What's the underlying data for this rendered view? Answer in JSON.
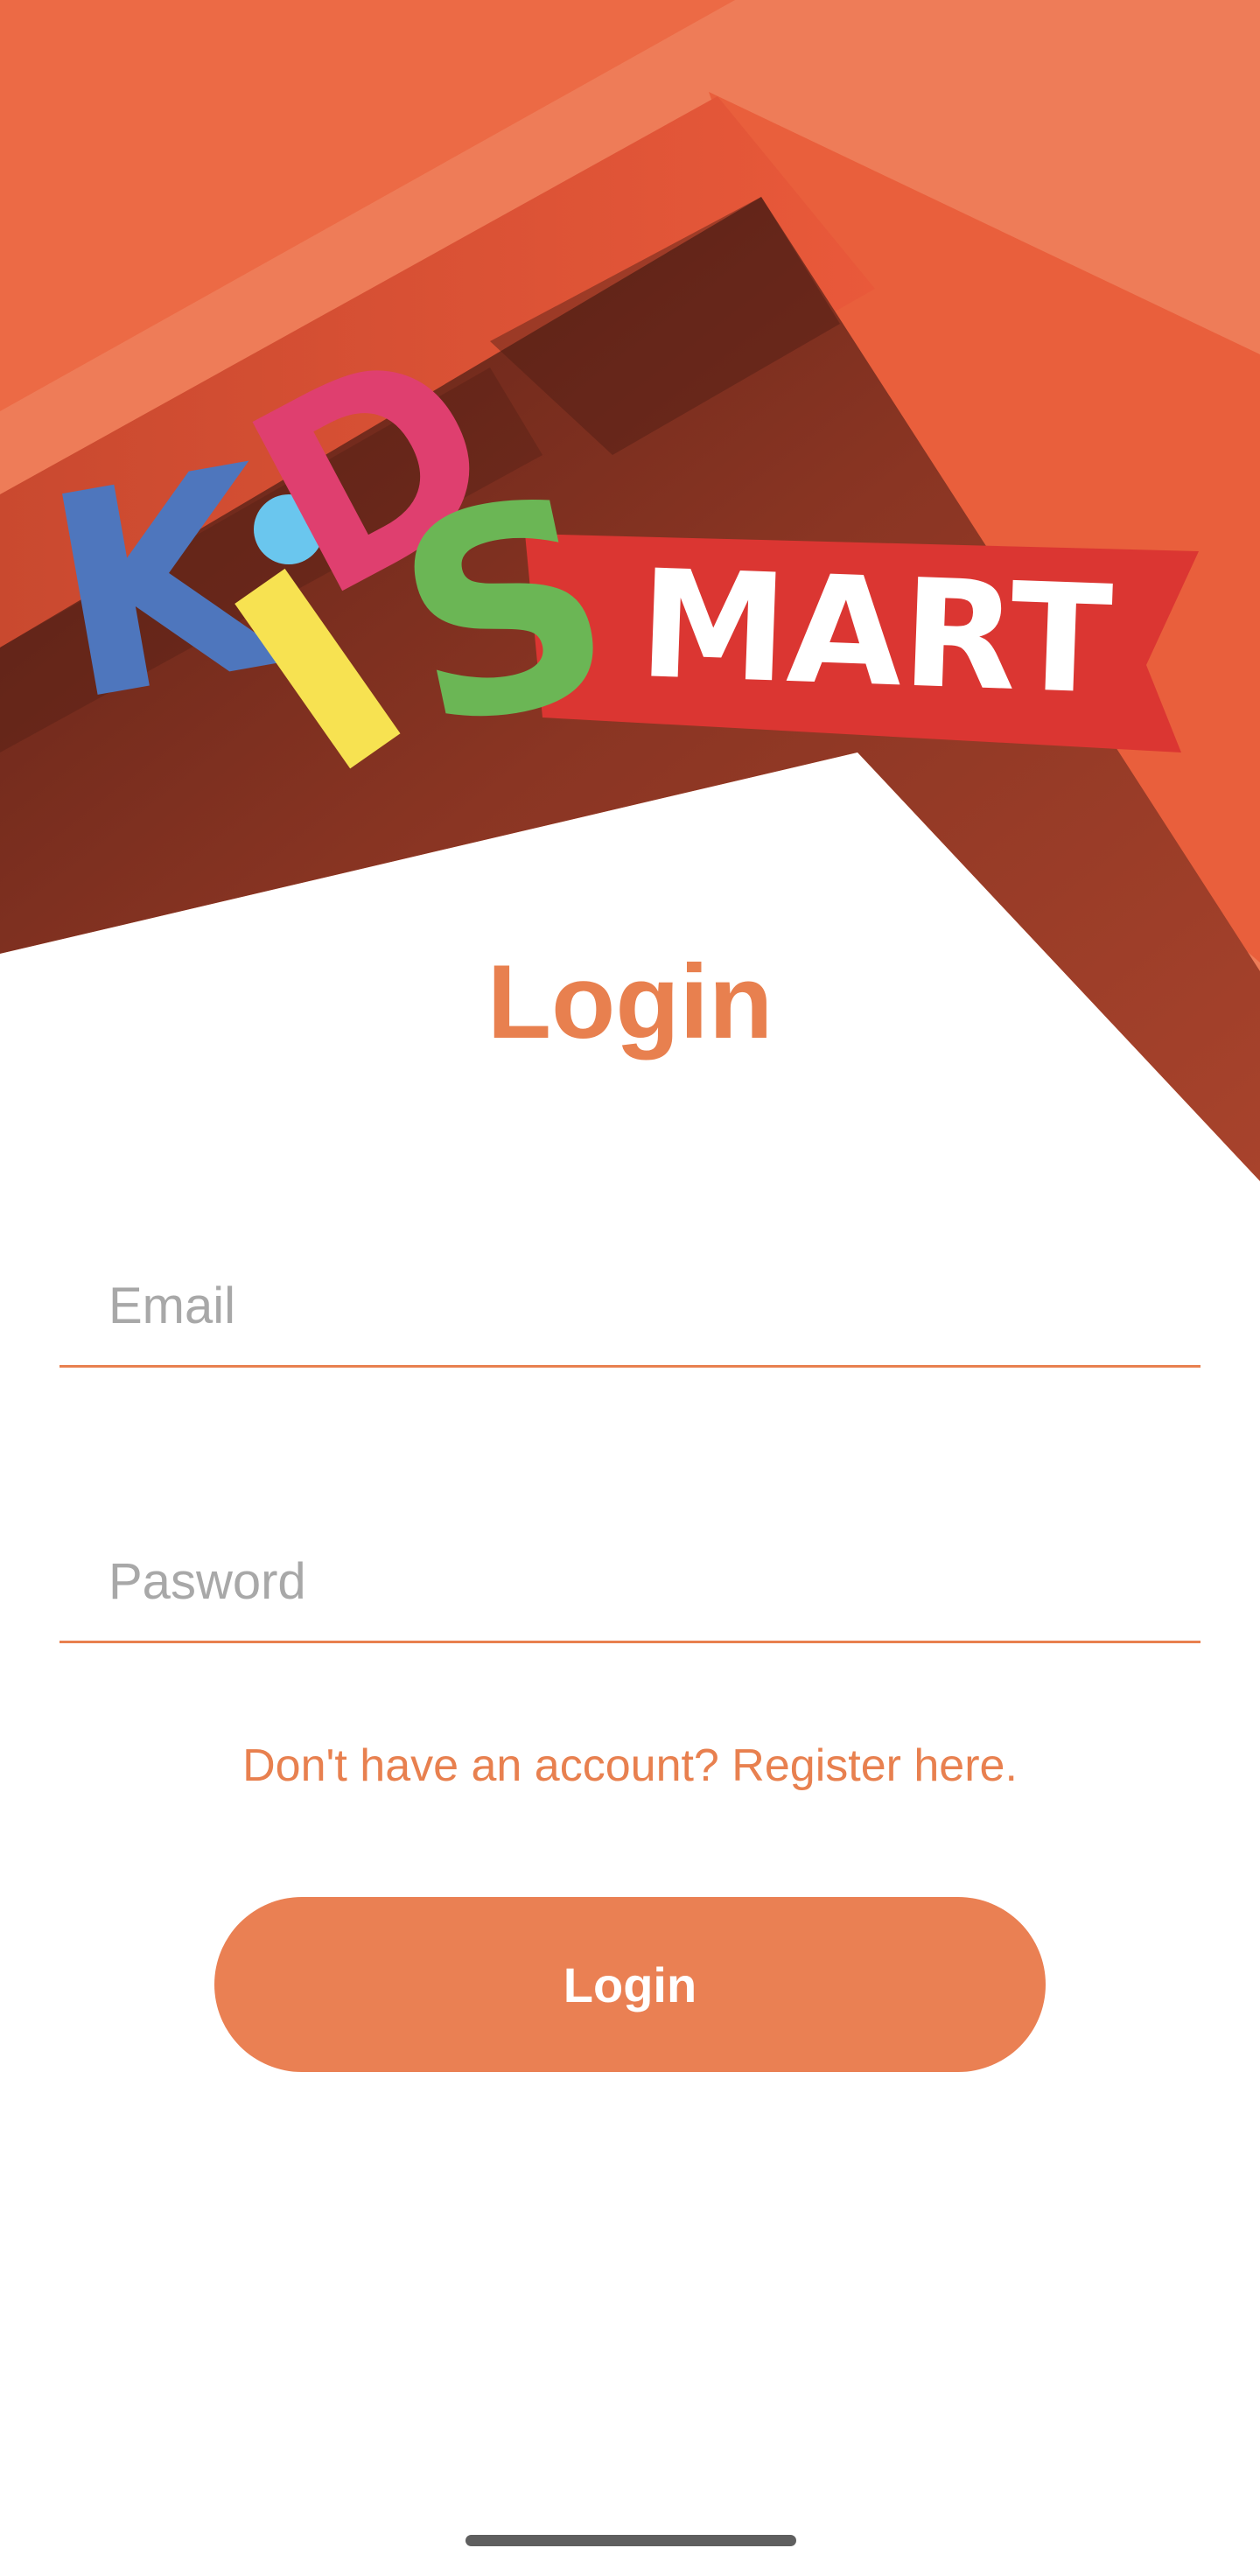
{
  "brand": {
    "logo_letters": [
      "K",
      "i",
      "D",
      "S"
    ],
    "logo_banner_text": "MART"
  },
  "title": "Login",
  "form": {
    "email_placeholder": "Email",
    "email_value": "",
    "password_placeholder": "Pasword",
    "password_value": ""
  },
  "register_link": "Don't have an account? Register here.",
  "login_button": "Login",
  "icons": {
    "home_indicator": "home-indicator-bar"
  },
  "colors": {
    "accent": "#E8804F",
    "button": "#EA8053",
    "header_light": "#EE7C58",
    "header_mid": "#E95F3C",
    "header_dark": "#A9432C",
    "header_darkest": "#742D1E",
    "logo_blue": "#4E76BD",
    "logo_pink": "#DF3F6F",
    "logo_cyan": "#6AC6EE",
    "logo_yellow": "#F7E251",
    "logo_green": "#6BB655",
    "logo_red": "#DB3632"
  }
}
